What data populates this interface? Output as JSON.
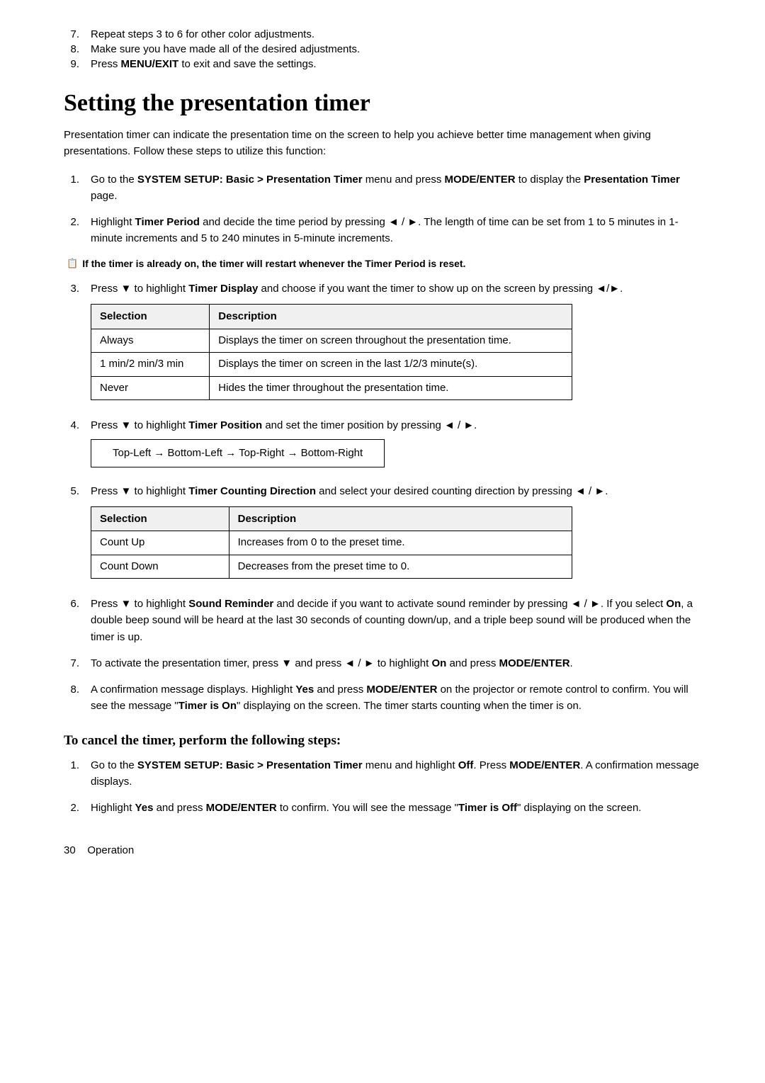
{
  "intro_steps": [
    {
      "num": "7.",
      "text": "Repeat steps 3 to 6 for other color adjustments."
    },
    {
      "num": "8.",
      "text": "Make sure you have made all of the desired adjustments."
    },
    {
      "num": "9.",
      "text": "Press MENU/EXIT to exit and save the settings.",
      "bold_part": "MENU/EXIT"
    }
  ],
  "section_title": "Setting the presentation timer",
  "intro_paragraph": "Presentation timer can indicate the presentation time on the screen to help you achieve better time management when giving presentations. Follow these steps to utilize this function:",
  "steps": [
    {
      "num": "1.",
      "text_parts": [
        {
          "text": "Go to the ",
          "bold": false
        },
        {
          "text": "SYSTEM SETUP: Basic > Presentation Timer",
          "bold": true
        },
        {
          "text": " menu and press ",
          "bold": false
        },
        {
          "text": "MODE/\nENTER",
          "bold": true
        },
        {
          "text": " to display the ",
          "bold": false
        },
        {
          "text": "Presentation Timer",
          "bold": true
        },
        {
          "text": " page.",
          "bold": false
        }
      ]
    },
    {
      "num": "2.",
      "text_parts": [
        {
          "text": "Highlight ",
          "bold": false
        },
        {
          "text": "Timer Period",
          "bold": true
        },
        {
          "text": " and decide the time period by pressing ",
          "bold": false
        },
        {
          "text": "◄ / ►",
          "bold": false
        },
        {
          "text": ". The length of time can be set from 1 to 5 minutes in 1-minute increments and 5 to 240 minutes in 5-minute increments.",
          "bold": false
        }
      ]
    },
    {
      "num": "3.",
      "text_parts": [
        {
          "text": "Press ▼ to highlight ",
          "bold": false
        },
        {
          "text": "Timer Display",
          "bold": true
        },
        {
          "text": " and choose if you want the timer to show up on the screen by pressing ",
          "bold": false
        },
        {
          "text": "◄/►",
          "bold": false
        },
        {
          "text": ".",
          "bold": false
        }
      ],
      "has_table_1": true
    },
    {
      "num": "4.",
      "text_parts": [
        {
          "text": "Press ▼ to highlight ",
          "bold": false
        },
        {
          "text": "Timer Position",
          "bold": true
        },
        {
          "text": " and set the timer position by pressing ",
          "bold": false
        },
        {
          "text": "◄ / ►",
          "bold": false
        },
        {
          "text": ".",
          "bold": false
        }
      ],
      "has_position_box": true
    },
    {
      "num": "5.",
      "text_parts": [
        {
          "text": "Press ▼ to highlight ",
          "bold": false
        },
        {
          "text": "Timer Counting Direction",
          "bold": true
        },
        {
          "text": " and select your desired counting direction by pressing ",
          "bold": false
        },
        {
          "text": "◄ / ►",
          "bold": false
        },
        {
          "text": ".",
          "bold": false
        }
      ],
      "has_table_2": true
    },
    {
      "num": "6.",
      "text_parts": [
        {
          "text": "Press ▼ to highlight ",
          "bold": false
        },
        {
          "text": "Sound Reminder",
          "bold": true
        },
        {
          "text": " and decide if you want to activate sound reminder by pressing ",
          "bold": false
        },
        {
          "text": "◄ / ►",
          "bold": false
        },
        {
          "text": ". If you select ",
          "bold": false
        },
        {
          "text": "On",
          "bold": true
        },
        {
          "text": ", a double beep sound will be heard at the last 30 seconds of counting down/up, and a triple beep sound will be produced when the timer is up.",
          "bold": false
        }
      ]
    },
    {
      "num": "7.",
      "text_parts": [
        {
          "text": "To activate the presentation timer, press ▼ and press ",
          "bold": false
        },
        {
          "text": "◄ / ►",
          "bold": false
        },
        {
          "text": " to highlight ",
          "bold": false
        },
        {
          "text": "On",
          "bold": true
        },
        {
          "text": " and press ",
          "bold": false
        },
        {
          "text": "MODE/ENTER",
          "bold": true
        },
        {
          "text": ".",
          "bold": false
        }
      ]
    },
    {
      "num": "8.",
      "text_parts": [
        {
          "text": "A confirmation message displays. Highlight ",
          "bold": false
        },
        {
          "text": "Yes",
          "bold": true
        },
        {
          "text": " and press ",
          "bold": false
        },
        {
          "text": "MODE/ENTER",
          "bold": true
        },
        {
          "text": " on the projector or remote control to confirm. You will see the message \"",
          "bold": false
        },
        {
          "text": "Timer is On",
          "bold": true
        },
        {
          "text": "\" displaying on the screen. The timer starts counting when the timer is on.",
          "bold": false
        }
      ]
    }
  ],
  "note_text": "If the timer is already on, the timer will restart whenever the Timer Period is reset.",
  "table1_headers": [
    "Selection",
    "Description"
  ],
  "table1_rows": [
    {
      "selection": "Always",
      "description": "Displays the timer on screen throughout the presentation time."
    },
    {
      "selection": "1 min/2 min/3 min",
      "description": "Displays the timer on screen in the last 1/2/3 minute(s)."
    },
    {
      "selection": "Never",
      "description": "Hides the timer throughout the presentation time."
    }
  ],
  "position_box_text": "Top-Left → Bottom-Left → Top-Right → Bottom-Right",
  "table2_headers": [
    "Selection",
    "Description"
  ],
  "table2_rows": [
    {
      "selection": "Count Up",
      "description": "Increases from 0 to the preset time."
    },
    {
      "selection": "Count Down",
      "description": "Decreases from the preset time to 0."
    }
  ],
  "cancel_heading": "To cancel the timer, perform the following steps:",
  "cancel_steps": [
    {
      "num": "1.",
      "text_parts": [
        {
          "text": "Go to the ",
          "bold": false
        },
        {
          "text": "SYSTEM SETUP: Basic > Presentation Timer",
          "bold": true
        },
        {
          "text": " menu and highlight ",
          "bold": false
        },
        {
          "text": "Off",
          "bold": true
        },
        {
          "text": ". Press ",
          "bold": false
        },
        {
          "text": "MODE/ENTER",
          "bold": true
        },
        {
          "text": ". A confirmation message displays.",
          "bold": false
        }
      ]
    },
    {
      "num": "2.",
      "text_parts": [
        {
          "text": "Highlight ",
          "bold": false
        },
        {
          "text": "Yes",
          "bold": true
        },
        {
          "text": " and press ",
          "bold": false
        },
        {
          "text": "MODE/ENTER",
          "bold": true
        },
        {
          "text": " to confirm. You will see the message \"",
          "bold": false
        },
        {
          "text": "Timer is Off",
          "bold": true
        },
        {
          "text": "\" displaying on the screen.",
          "bold": false
        }
      ]
    }
  ],
  "footer": {
    "page_number": "30",
    "section_label": "Operation"
  }
}
